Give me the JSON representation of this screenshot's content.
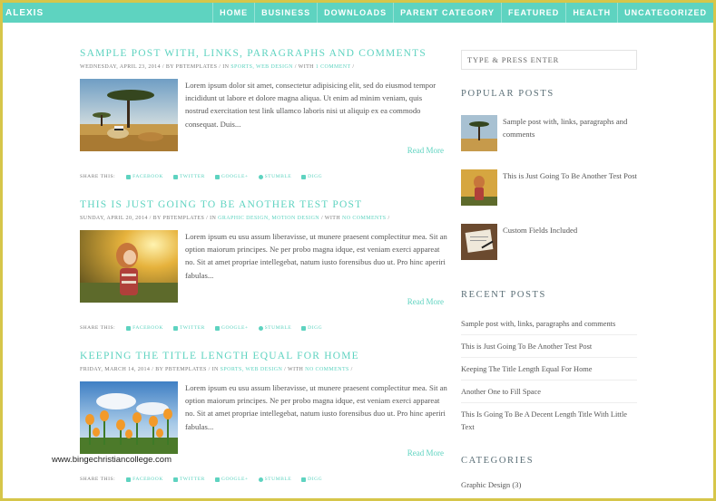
{
  "site": {
    "logo": "ALEXIS"
  },
  "nav": {
    "items": [
      "HOME",
      "BUSINESS",
      "DOWNLOADS",
      "PARENT CATEGORY",
      "FEATURED",
      "HEALTH",
      "UNCATEGORIZED"
    ]
  },
  "posts": [
    {
      "title": "SAMPLE POST WITH, LINKS, PARAGRAPHS AND COMMENTS",
      "meta": {
        "date": "WEDNESDAY, APRIL 23, 2014",
        "by": " / BY ",
        "author": "PBTEMPLATES",
        "in": " / IN ",
        "categories": "SPORTS, WEB DESIGN",
        "with": " / WITH ",
        "comments": "1 COMMENT",
        "end": " /"
      },
      "excerpt": "Lorem ipsum dolor sit amet, consectetur adipisicing elit, sed do eiusmod tempor incididunt ut labore et dolore magna aliqua. Ut enim ad minim veniam, quis nostrud exercitation test link ullamco laboris nisi ut aliquip ex ea commodo consequat. Duis...",
      "read_more": "Read More"
    },
    {
      "title": "THIS IS JUST GOING TO BE ANOTHER TEST POST",
      "meta": {
        "date": "SUNDAY, APRIL 20, 2014",
        "by": " / BY ",
        "author": "PBTEMPLATES",
        "in": " / IN ",
        "categories": "GRAPHIC DESIGN, MOTION DESIGN",
        "with": " / WITH ",
        "comments": "NO COMMENTS",
        "end": " /"
      },
      "excerpt": "Lorem ipsum eu usu assum liberavisse, ut munere praesent complectitur mea. Sit an option maiorum principes. Ne per probo magna idque, est veniam exerci appareat no. Sit at amet propriae intellegebat, natum iusto forensibus duo ut. Pro hinc aperiri fabulas...",
      "read_more": "Read More"
    },
    {
      "title": "KEEPING THE TITLE LENGTH EQUAL FOR HOME",
      "meta": {
        "date": "FRIDAY, MARCH 14, 2014",
        "by": " / BY ",
        "author": "PBTEMPLATES",
        "in": " / IN ",
        "categories": "SPORTS, WEB DESIGN",
        "with": " / WITH ",
        "comments": "NO COMMENTS",
        "end": " /"
      },
      "excerpt": "Lorem ipsum eu usu assum liberavisse, ut munere praesent complectitur mea. Sit an option maiorum principes. Ne per probo magna idque, est veniam exerci appareat no. Sit at amet propriae intellegebat, natum iusto forensibus duo ut. Pro hinc aperiri fabulas...",
      "read_more": "Read More"
    }
  ],
  "share": {
    "label": "SHARE THIS:",
    "facebook": "FACEBOOK",
    "twitter": "TWITTER",
    "google": "GOOGLE+",
    "stumble": "STUMBLE",
    "digg": "DIGG"
  },
  "sidebar": {
    "search_placeholder": "TYPE & PRESS ENTER",
    "popular_title": "POPULAR POSTS",
    "popular": [
      "Sample post with, links, paragraphs and comments",
      "This is Just Going To Be Another Test Post",
      "Custom Fields Included"
    ],
    "recent_title": "RECENT POSTS",
    "recent": [
      "Sample post with, links, paragraphs and comments",
      "This is Just Going To Be Another Test Post",
      "Keeping The Title Length Equal For Home",
      "Another One to Fill Space",
      "This Is Going To Be A Decent Length Title With Little Text"
    ],
    "categories_title": "CATEGORIES",
    "categories": [
      "Graphic Design (3)"
    ]
  },
  "watermark": "www.bingechristiancollege.com",
  "colors": {
    "accent": "#5ed3c0",
    "frame": "#d6c64a",
    "text": "#555555"
  }
}
